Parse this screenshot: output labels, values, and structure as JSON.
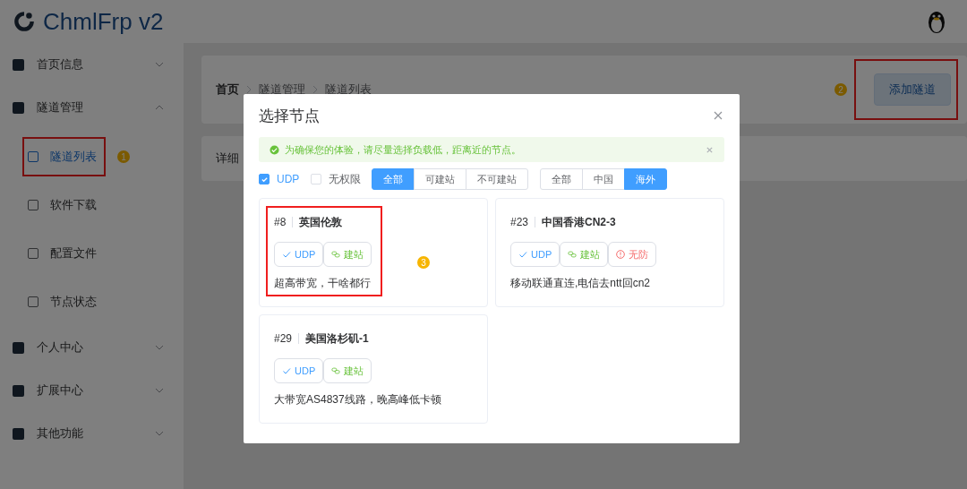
{
  "app": {
    "title": "ChmlFrp v2"
  },
  "sidebar": {
    "items": [
      {
        "label": "首页信息",
        "expanded": false
      },
      {
        "label": "隧道管理",
        "expanded": true,
        "children": [
          {
            "label": "隧道列表",
            "selected": true,
            "annotation": "1"
          },
          {
            "label": "软件下载",
            "selected": false
          },
          {
            "label": "配置文件",
            "selected": false
          },
          {
            "label": "节点状态",
            "selected": false
          }
        ]
      },
      {
        "label": "个人中心",
        "expanded": false
      },
      {
        "label": "扩展中心",
        "expanded": false
      },
      {
        "label": "其他功能",
        "expanded": false
      }
    ]
  },
  "breadcrumb": [
    "首页",
    "隧道管理",
    "隧道列表"
  ],
  "add_button": {
    "label": "添加隧道",
    "annotation": "2"
  },
  "detail_card": {
    "title": "详细"
  },
  "dialog": {
    "title": "选择节点",
    "alert": "为确保您的体验，请尽量选择负载低，距离近的节点。",
    "checkboxes": [
      {
        "label": "UDP",
        "checked": true
      },
      {
        "label": "无权限",
        "checked": false
      }
    ],
    "filter_groups": [
      [
        {
          "label": "全部",
          "selected": true
        },
        {
          "label": "可建站",
          "selected": false
        },
        {
          "label": "不可建站",
          "selected": false
        }
      ],
      [
        {
          "label": "全部",
          "selected": false
        },
        {
          "label": "中国",
          "selected": false
        },
        {
          "label": "海外",
          "selected": true
        }
      ]
    ],
    "nodes": [
      {
        "id": "#8",
        "name": "英国伦敦",
        "tags": [
          {
            "kind": "udp",
            "label": "UDP"
          },
          {
            "kind": "site",
            "label": "建站"
          }
        ],
        "description": "超高带宽，干啥都行",
        "annotation": "3"
      },
      {
        "id": "#23",
        "name": "中国香港CN2-3",
        "tags": [
          {
            "kind": "udp",
            "label": "UDP"
          },
          {
            "kind": "site",
            "label": "建站"
          },
          {
            "kind": "nodefense",
            "label": "无防"
          }
        ],
        "description": "移动联通直连,电信去ntt回cn2"
      },
      {
        "id": "#29",
        "name": "美国洛杉矶-1",
        "tags": [
          {
            "kind": "udp",
            "label": "UDP"
          },
          {
            "kind": "site",
            "label": "建站"
          }
        ],
        "description": "大带宽AS4837线路，晚高峰低卡顿"
      }
    ]
  }
}
